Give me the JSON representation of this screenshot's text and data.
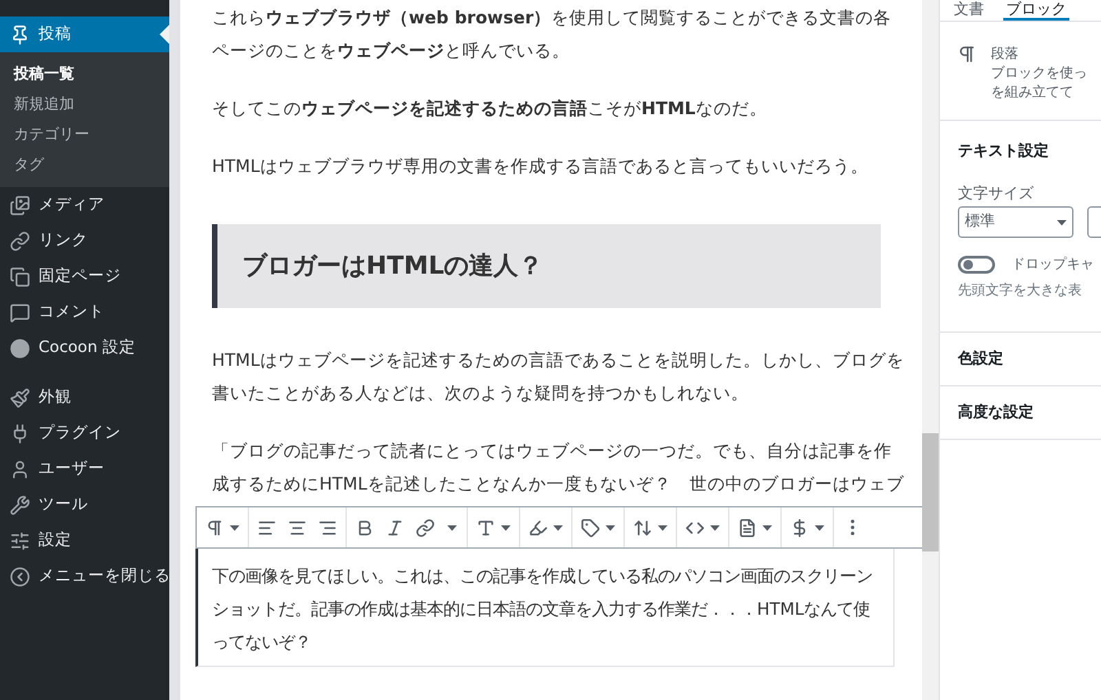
{
  "sidebar": {
    "groups": [
      {
        "items": [
          {
            "label": "投稿",
            "selected": true,
            "children": [
              {
                "label": "投稿一覧",
                "selected": true
              },
              {
                "label": "新規追加",
                "selected": false
              },
              {
                "label": "カテゴリー",
                "selected": false
              },
              {
                "label": "タグ",
                "selected": false
              }
            ]
          },
          {
            "label": "メディア",
            "selected": false
          },
          {
            "label": "リンク",
            "selected": false
          },
          {
            "label": "固定ページ",
            "selected": false
          },
          {
            "label": "コメント",
            "selected": false
          },
          {
            "label": "Cocoon 設定",
            "selected": false
          }
        ]
      },
      {
        "items": [
          {
            "label": "外観",
            "selected": false
          },
          {
            "label": "プラグイン",
            "selected": false
          },
          {
            "label": "ユーザー",
            "selected": false
          },
          {
            "label": "ツール",
            "selected": false
          },
          {
            "label": "設定",
            "selected": false
          },
          {
            "label": "メニューを閉じる",
            "selected": false
          }
        ]
      }
    ]
  },
  "content": {
    "blocks": [
      {
        "kind": "paragraph",
        "text": "これら**ウェブブラウザ（web browser）**を使用して閲覧することができる文書の各ページのことを**ウェブページ**と呼んでいる。"
      },
      {
        "kind": "paragraph",
        "text": "そしてこの**ウェブページを記述するための言語**こそが**HTML**なのだ。"
      },
      {
        "kind": "paragraph",
        "text": "HTMLはウェブブラウザ専用の文書を作成する言語であると言ってもいいだろう。"
      },
      {
        "kind": "heading",
        "text": "ブロガーはHTMLの達人？"
      },
      {
        "kind": "paragraph",
        "text": "HTMLはウェブページを記述するための言語であることを説明した。しかし、ブログを書いたことがある人などは、次のような疑問を持つかもしれない。"
      },
      {
        "kind": "paragraph",
        "text": "「ブログの記事だって読者にとってはウェブページの一つだ。でも、自分は記事を作成するためにHTMLを記述したことなんか一度もないぞ？　世の中のブロガーはウェブ"
      },
      {
        "kind": "selected",
        "text": "下の画像を見てほしい。これは、この記事を作成している私のパソコン画面のスクリーンショットだ。記事の作成は基本的に日本語の文章を入力する作業だ．．．HTMLなんて使ってないぞ？"
      }
    ]
  },
  "inspector": {
    "tabs": [
      {
        "label": "文書",
        "selected": false
      },
      {
        "label": "ブロック",
        "selected": true
      }
    ],
    "block_name": "段落",
    "block_description": [
      "ブロックを使っ",
      "を組み立てて"
    ],
    "text_settings": {
      "title": "テキスト設定",
      "font_size_label": "文字サイズ",
      "font_size_value": "標準",
      "drop_cap": {
        "label": "ドロップキャ",
        "on": false
      },
      "help": "先頭文字を大きな表"
    },
    "panels": [
      "色設定",
      "高度な設定"
    ]
  }
}
